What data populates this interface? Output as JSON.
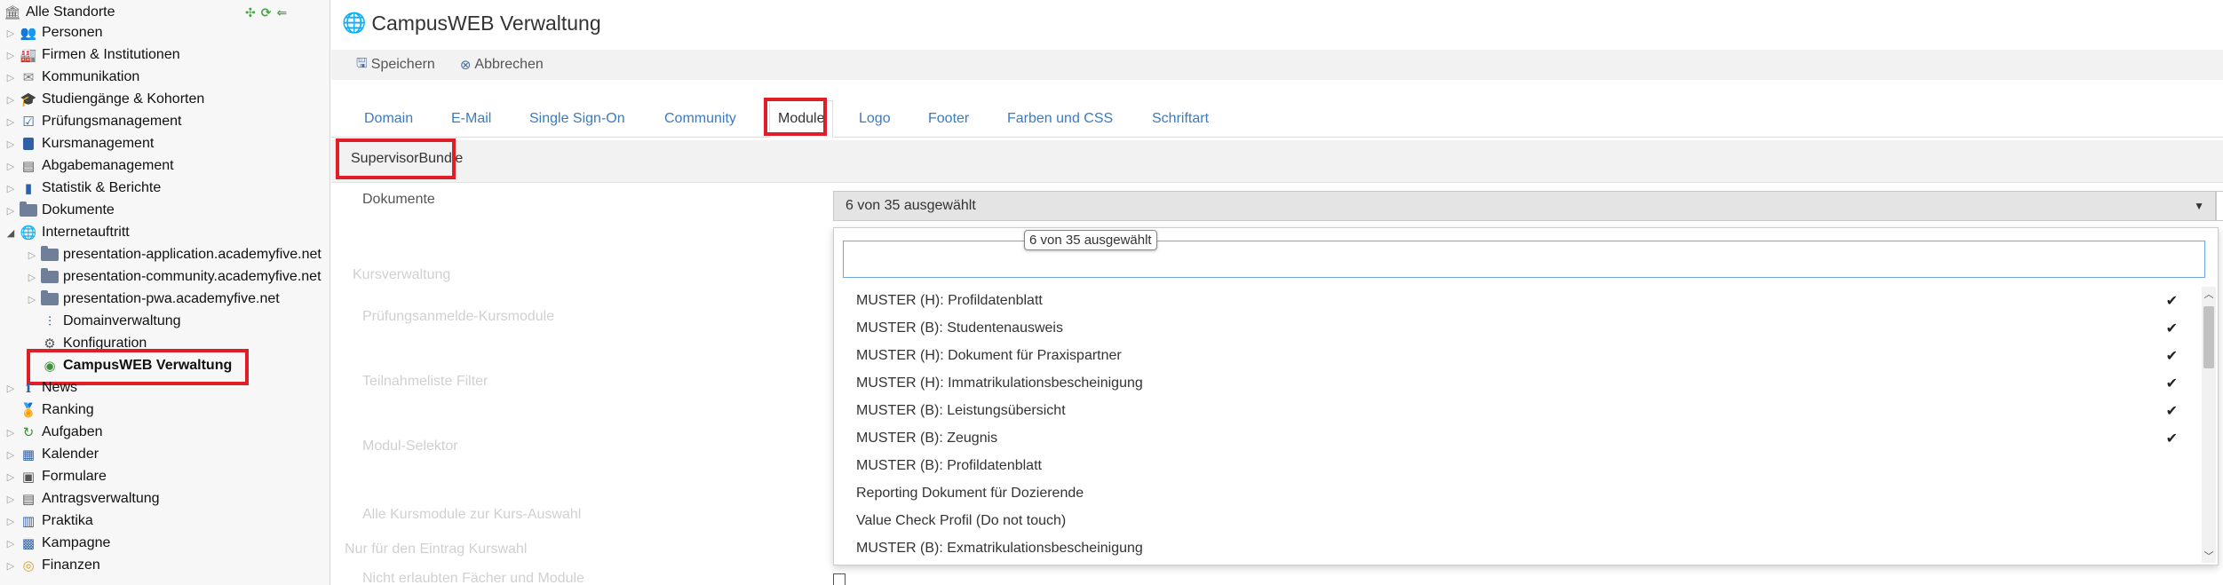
{
  "sidebar": {
    "root_label": "Alle Standorte",
    "items": [
      {
        "label": "Personen",
        "icon": "persons-icon"
      },
      {
        "label": "Firmen & Institutionen",
        "icon": "company-icon"
      },
      {
        "label": "Kommunikation",
        "icon": "mail-icon"
      },
      {
        "label": "Studiengänge & Kohorten",
        "icon": "graduation-icon"
      },
      {
        "label": "Prüfungsmanagement",
        "icon": "exam-icon"
      },
      {
        "label": "Kursmanagement",
        "icon": "book-icon"
      },
      {
        "label": "Abgabemanagement",
        "icon": "submission-icon"
      },
      {
        "label": "Statistik & Berichte",
        "icon": "bar-chart-icon"
      },
      {
        "label": "Dokumente",
        "icon": "folder-icon"
      },
      {
        "label": "Internetauftritt",
        "icon": "globe-icon"
      }
    ],
    "internet_children": [
      {
        "label": "presentation-application.academyfive.net"
      },
      {
        "label": "presentation-community.academyfive.net"
      },
      {
        "label": "presentation-pwa.academyfive.net"
      },
      {
        "label": "Domainverwaltung"
      },
      {
        "label": "Konfiguration"
      },
      {
        "label": "CampusWEB Verwaltung"
      }
    ],
    "items_after": [
      {
        "label": "News",
        "icon": "info-icon"
      },
      {
        "label": "Ranking",
        "icon": "award-icon"
      },
      {
        "label": "Aufgaben",
        "icon": "tasks-icon"
      },
      {
        "label": "Kalender",
        "icon": "calendar-icon"
      },
      {
        "label": "Formulare",
        "icon": "form-icon"
      },
      {
        "label": "Antragsverwaltung",
        "icon": "application-icon"
      },
      {
        "label": "Praktika",
        "icon": "internship-icon"
      },
      {
        "label": "Kampagne",
        "icon": "campaign-icon"
      },
      {
        "label": "Finanzen",
        "icon": "coins-icon"
      }
    ]
  },
  "header": {
    "title": "CampusWEB Verwaltung"
  },
  "toolbar": {
    "save_label": "Speichern",
    "cancel_label": "Abbrechen"
  },
  "tabs": [
    {
      "label": "Domain"
    },
    {
      "label": "E-Mail"
    },
    {
      "label": "Single Sign-On"
    },
    {
      "label": "Community"
    },
    {
      "label": "Module"
    },
    {
      "label": "Logo"
    },
    {
      "label": "Footer"
    },
    {
      "label": "Farben und CSS"
    },
    {
      "label": "Schriftart"
    }
  ],
  "active_tab": "Module",
  "subtab": {
    "label": "SupervisorBundle"
  },
  "form": {
    "documents_label": "Dokumente",
    "select_value": "6 von 35 ausgewählt",
    "tooltip": "6 von 35 ausgewählt",
    "search_placeholder": "",
    "faded_labels": [
      "Kursverwaltung",
      "Prüfungsanmelde-Kursmodule",
      "Teilnahmeliste Filter",
      "Modul-Selektor",
      "Alle Kursmodule zur Kurs-Auswahl",
      "Nur für den Eintrag Kurswahl",
      "Nicht erlaubten Fächer und Module"
    ]
  },
  "dropdown_items": [
    {
      "label": "MUSTER (H): Profildatenblatt",
      "selected": true
    },
    {
      "label": "MUSTER (B): Studentenausweis",
      "selected": true
    },
    {
      "label": "MUSTER (H): Dokument für Praxispartner",
      "selected": true
    },
    {
      "label": "MUSTER (H): Immatrikulationsbescheinigung",
      "selected": true
    },
    {
      "label": "MUSTER (B): Leistungsübersicht",
      "selected": true
    },
    {
      "label": "MUSTER (B): Zeugnis",
      "selected": true
    },
    {
      "label": "MUSTER (B): Profildatenblatt",
      "selected": false
    },
    {
      "label": "Reporting Dokument für Dozierende",
      "selected": false
    },
    {
      "label": "Value Check Profil (Do not touch)",
      "selected": false
    },
    {
      "label": "MUSTER (B): Exmatrikulationsbescheinigung",
      "selected": false
    }
  ],
  "colors": {
    "highlight": "#e01e28",
    "link": "#3b7bbf"
  }
}
